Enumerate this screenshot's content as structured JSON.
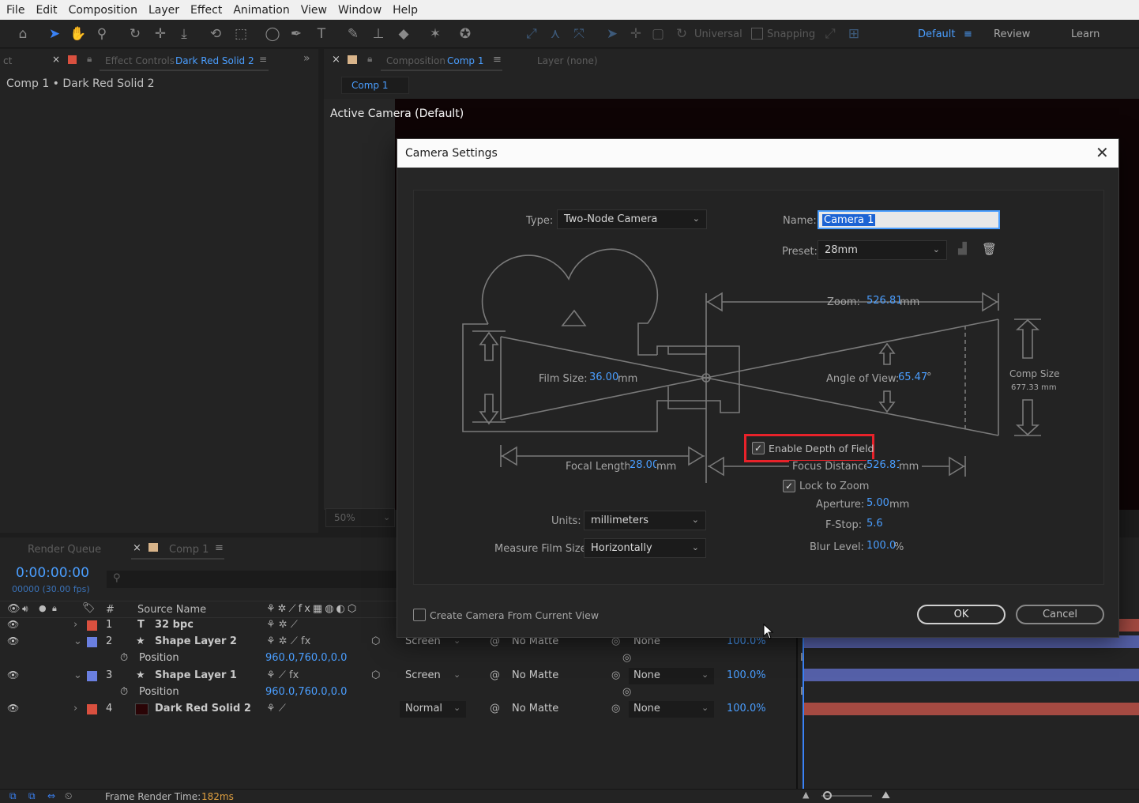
{
  "menu": [
    "File",
    "Edit",
    "Composition",
    "Layer",
    "Effect",
    "Animation",
    "View",
    "Window",
    "Help"
  ],
  "toolbar": {
    "universal_label": "Universal",
    "snapping_label": "Snapping",
    "workspaces": [
      "Default",
      "Review",
      "Learn"
    ],
    "active_workspace": "Default"
  },
  "effect_controls": {
    "tab_cut": "ct",
    "tab_label": "Effect Controls",
    "tab_target": "Dark Red Solid 2",
    "breadcrumb": "Comp 1 • Dark Red Solid 2"
  },
  "composition_panel": {
    "tab_label": "Composition",
    "tab_target": "Comp 1",
    "layer_tab": "Layer (none)",
    "subtab": "Comp 1",
    "active_camera": "Active Camera (Default)",
    "zoom": "50%"
  },
  "camera_dialog": {
    "title": "Camera Settings",
    "type_label": "Type:",
    "type_value": "Two-Node Camera",
    "name_label": "Name:",
    "name_value": "Camera 1",
    "preset_label": "Preset:",
    "preset_value": "28mm",
    "zoom_label": "Zoom:",
    "zoom_value": "526.81",
    "zoom_unit": "mm",
    "film_size_label": "Film Size:",
    "film_size_value": "36.00",
    "film_size_unit": "mm",
    "angle_label": "Angle of View:",
    "angle_value": "65.47",
    "angle_unit": "°",
    "comp_size_label": "Comp Size",
    "comp_size_value": "677.33 mm",
    "dof_label": "Enable Depth of Field",
    "dof_checked": true,
    "focal_label": "Focal Length:",
    "focal_value": "28.00",
    "focal_unit": "mm",
    "focus_label": "Focus Distance:",
    "focus_value": "526.81",
    "focus_unit": "mm",
    "lock_label": "Lock to Zoom",
    "lock_checked": true,
    "aperture_label": "Aperture:",
    "aperture_value": "5.00",
    "aperture_unit": "mm",
    "fstop_label": "F-Stop:",
    "fstop_value": "5.6",
    "blur_label": "Blur Level:",
    "blur_value": "100.0",
    "blur_unit": "%",
    "units_label": "Units:",
    "units_value": "millimeters",
    "measure_label": "Measure Film Size:",
    "measure_value": "Horizontally",
    "create_label": "Create Camera From Current View",
    "create_checked": false,
    "ok_label": "OK",
    "cancel_label": "Cancel"
  },
  "timeline": {
    "render_queue_tab": "Render Queue",
    "comp_tab": "Comp 1",
    "timecode": "0:00:00:00",
    "frame_info": "00000 (30.00 fps)",
    "hash_col": "#",
    "source_col": "Source Name",
    "layers": [
      {
        "num": "1",
        "name": "32 bpc",
        "icon": "text-icon",
        "color": "#d9503f",
        "expanded": false,
        "mode": "",
        "matte": "",
        "parent": "",
        "opacity": ""
      },
      {
        "num": "2",
        "name": "Shape Layer 2",
        "icon": "star-icon",
        "color": "#6a7fe0",
        "expanded": true,
        "mode": "Screen",
        "matte": "No Matte",
        "parent": "None",
        "opacity": "100.0%"
      },
      {
        "num": "3",
        "name": "Shape Layer 1",
        "icon": "star-icon",
        "color": "#6a7fe0",
        "expanded": true,
        "mode": "Screen",
        "matte": "No Matte",
        "parent": "None",
        "opacity": "100.0%"
      },
      {
        "num": "4",
        "name": "Dark Red Solid 2",
        "icon": "solid-icon",
        "color": "#d9503f",
        "expanded": false,
        "mode": "Normal",
        "matte": "No Matte",
        "parent": "None",
        "opacity": "100.0%"
      }
    ],
    "property_label": "Position",
    "position_value": "960.0,760.0,0.0",
    "footer_label": "Frame Render Time:",
    "footer_value": "182ms"
  },
  "colors": {
    "accent_blue": "#4a9eff",
    "highlight_red": "#e8222a",
    "layer_red": "#d9503f",
    "layer_blue": "#6a7fe0"
  }
}
